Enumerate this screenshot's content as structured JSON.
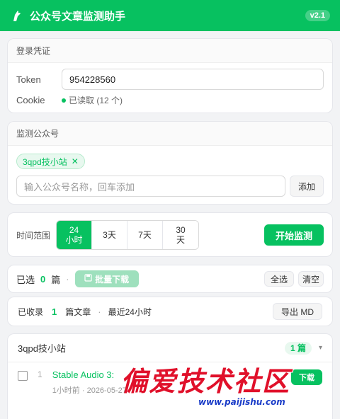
{
  "header": {
    "title": "公众号文章监测助手",
    "version": "v2.1"
  },
  "credentials": {
    "section_title": "登录凭证",
    "token_label": "Token",
    "token_value": "954228560",
    "cookie_label": "Cookie",
    "cookie_status": "已读取 (12 个)"
  },
  "accounts": {
    "section_title": "监测公众号",
    "tags": [
      "3qpd技小站"
    ],
    "input_placeholder": "输入公众号名称，回车添加",
    "add_button": "添加"
  },
  "time_range": {
    "label": "时间范围",
    "options": [
      "24\n小时",
      "3天",
      "7天",
      "30\n天"
    ],
    "selected": 0,
    "start_button": "开始监测"
  },
  "selection": {
    "selected_label": "已选",
    "selected_count": "0",
    "unit": "篇",
    "separator": "·",
    "batch_download": "批量下载",
    "select_all": "全选",
    "clear": "清空"
  },
  "summary": {
    "collected_label": "已收录",
    "collected_count": "1",
    "unit": "篇文章",
    "separator": "·",
    "range_text": "最近24小时",
    "export_button": "导出 MD"
  },
  "group": {
    "name": "3qpd技小站",
    "count_badge": "1 篇",
    "toggle_icon": "chevron-down",
    "articles": [
      {
        "index": "1",
        "title": "Stable Audio 3: ",
        "meta": "1小时前 · 2026-05-27",
        "download_label": "下载"
      }
    ]
  },
  "watermark": {
    "text": "偏爱技术社区",
    "url": "www.paijishu.com"
  },
  "colors": {
    "accent": "#07c160",
    "watermark_red": "#e0102a",
    "watermark_blue": "#1a3cc8"
  }
}
